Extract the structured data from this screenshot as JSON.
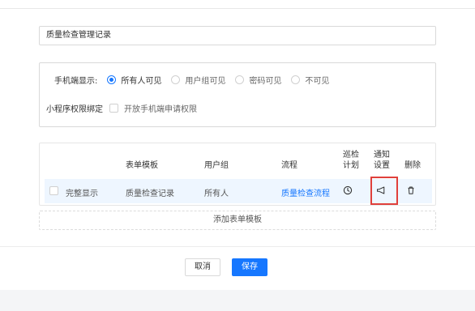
{
  "form": {
    "name_value": "质量检查管理记录"
  },
  "permissions": {
    "mobile_display_label": "手机端显示:",
    "options": [
      {
        "label": "所有人可见",
        "selected": true
      },
      {
        "label": "用户组可见",
        "selected": false
      },
      {
        "label": "密码可见",
        "selected": false
      },
      {
        "label": "不可见",
        "selected": false
      }
    ],
    "miniprogram_label": "小程序权限绑定",
    "open_mobile_request_label": "开放手机端申请权限"
  },
  "table": {
    "headers": {
      "form_template": "表单模板",
      "user_group": "用户组",
      "flow": "流程",
      "patrol_plan_line1": "巡检",
      "patrol_plan_line2": "计划",
      "notify_setting_line1": "通知",
      "notify_setting_line2": "设置",
      "delete": "删除"
    },
    "rows": [
      {
        "display_label": "完整显示",
        "form_template": "质量检查记录",
        "user_group": "所有人",
        "flow": "质量检查流程",
        "icons": [
          "clock-icon",
          "megaphone-icon",
          "trash-icon"
        ]
      }
    ],
    "add_template_label": "添加表单模板"
  },
  "footer": {
    "cancel_label": "取消",
    "save_label": "保存"
  },
  "colors": {
    "accent": "#1677ff",
    "highlight": "#e0403b",
    "row_bg": "#eef6ff"
  }
}
